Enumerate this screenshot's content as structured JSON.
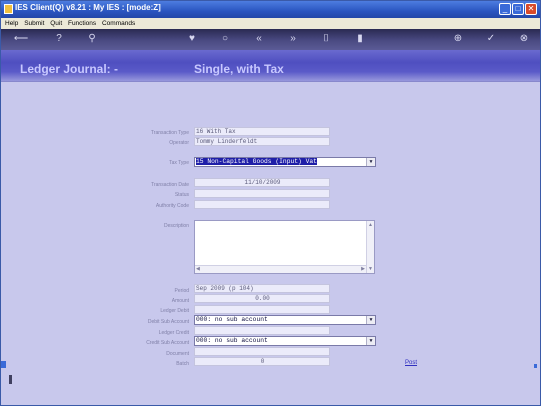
{
  "window": {
    "title": "IES Client(Q) v8.21 : My IES :     [mode:Z]"
  },
  "menu": [
    "Help",
    "Submit",
    "Quit",
    "Functions",
    "Commands"
  ],
  "toolbar_icons": [
    "back-icon",
    "help-icon",
    "search-icon",
    "heart-icon",
    "circle-icon",
    "rewind-icon",
    "forward-icon",
    "tool-icon",
    "delete-icon",
    "add-icon",
    "ok-icon",
    "close-icon"
  ],
  "header": {
    "title": "Ledger Journal: -",
    "subtitle": "Single, with Tax"
  },
  "form": {
    "transaction_type": {
      "label": "Transaction Type",
      "value": "16 With Tax"
    },
    "operator": {
      "label": "Operator",
      "value": "Tommy Linderfeldt"
    },
    "tax_type": {
      "label": "Tax Type",
      "value": "15 Non-Capital Goods (Input) Vat"
    },
    "transaction_date": {
      "label": "Transaction Date",
      "value": "11/10/2009"
    },
    "status": {
      "label": "Status",
      "value": ""
    },
    "authority_code": {
      "label": "Authority Code",
      "value": ""
    },
    "description": {
      "label": "Description",
      "value": ""
    },
    "period": {
      "label": "Period",
      "value": "Sep 2009 (p 104)"
    },
    "amount": {
      "label": "Amount",
      "value": "0.00"
    },
    "ledger_debit": {
      "label": "Ledger Debit",
      "value": ""
    },
    "debit_sub_account": {
      "label": "Debit Sub Account",
      "value": "000: no sub account"
    },
    "ledger_credit": {
      "label": "Ledger Credit",
      "value": ""
    },
    "credit_sub_account": {
      "label": "Credit Sub Account",
      "value": "000: no sub account"
    },
    "document": {
      "label": "Document",
      "value": ""
    },
    "batch": {
      "label": "Batch",
      "value": "0"
    }
  },
  "actions": {
    "post": "Post"
  }
}
